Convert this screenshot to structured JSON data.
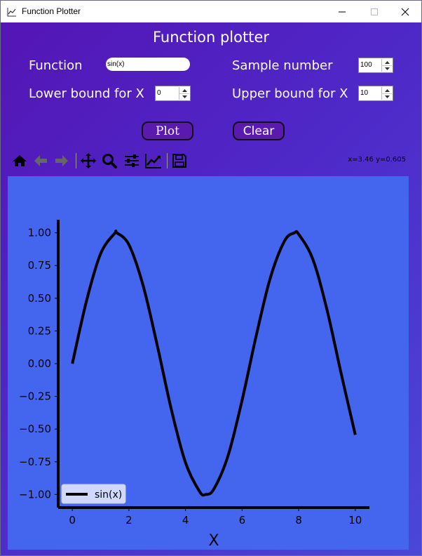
{
  "window": {
    "title": "Function Plotter",
    "heading": "Function plotter"
  },
  "form": {
    "function_label": "Function",
    "function_value": "sin(x)",
    "sample_label": "Sample number",
    "sample_value": "100",
    "lower_label": "Lower bound for X",
    "lower_value": "0",
    "upper_label": "Upper bound for X",
    "upper_value": "10"
  },
  "buttons": {
    "plot_label": "Plot",
    "clear_label": "Clear"
  },
  "toolbar": {
    "items": [
      "home-icon",
      "back-arrow-icon",
      "forward-arrow-icon",
      "pan-icon",
      "zoom-icon",
      "configure-subplots-icon",
      "edit-axis-icon",
      "save-icon"
    ],
    "coordinate_readout": "x=3.46 y=0.605"
  },
  "colors": {
    "background_gradient_start": "#5415b5",
    "background_gradient_end": "#4a48d6",
    "plot_background": "#4466ee",
    "button_fill": "#5a1ab0",
    "line_color": "#000000"
  },
  "chart_data": {
    "type": "line",
    "xlabel": "X",
    "series": [
      {
        "name": "sin(x)",
        "x": [
          0,
          0.5,
          1,
          1.5,
          1.57,
          2,
          2.5,
          3,
          3.5,
          4,
          4.5,
          4.71,
          5,
          5.5,
          6,
          6.5,
          7,
          7.5,
          7.85,
          8,
          8.5,
          9,
          9.5,
          10
        ],
        "y": [
          0,
          0.479,
          0.841,
          0.997,
          1.0,
          0.909,
          0.598,
          0.141,
          -0.351,
          -0.757,
          -0.978,
          -1.0,
          -0.959,
          -0.706,
          -0.279,
          0.215,
          0.657,
          0.938,
          1.0,
          0.989,
          0.798,
          0.412,
          -0.075,
          -0.544
        ]
      }
    ],
    "xticks": [
      "0",
      "2",
      "4",
      "6",
      "8",
      "10"
    ],
    "yticks": [
      "−1.00",
      "−0.75",
      "−0.50",
      "−0.25",
      "0.00",
      "0.25",
      "0.50",
      "0.75",
      "1.00"
    ],
    "xlim": [
      -0.5,
      10.5
    ],
    "ylim": [
      -1.1,
      1.1
    ],
    "legend": "lower-left",
    "grid": false
  }
}
